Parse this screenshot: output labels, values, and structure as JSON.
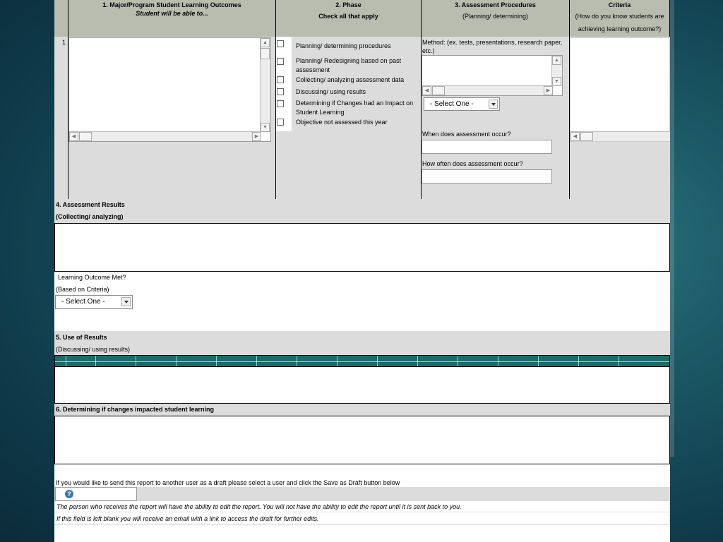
{
  "table_header": {
    "col1_title": "1. Major/Program Student Learning Outcomes",
    "col1_sub": "Student will be able to...",
    "col2_title": "2. Phase",
    "col2_sub": "Check all that apply",
    "col3_title": "3. Assessment Procedures",
    "col3_sub": "(Planning/ determining)",
    "col4_title": "Criteria",
    "col4_sub1": "(How do you know students are",
    "col4_sub2": "achieving learning outcome?)"
  },
  "row": {
    "number": "1",
    "phases": [
      "Planning/ determining procedures",
      "Planning/ Redesigning based on past assessment",
      "Collecting/ analyzing assessment data",
      "Discussing/ using results",
      "Determining if Changes had an Impact on Student Learning",
      "Objective not assessed this year"
    ],
    "method_label": "Method: (ex. tests, presentations, research paper, etc.)",
    "method_select": "- Select One -",
    "when_label": "When does assessment occur?",
    "often_label": "How often does assessment occur?"
  },
  "section4": {
    "title": "4. Assessment Results",
    "subtitle": "(Collecting/ analyzing)",
    "met_label": "Learning Outcome Met?",
    "met_sub": "(Based on Criteria)",
    "met_select": "- Select One -"
  },
  "section5": {
    "title": "5. Use of Results",
    "subtitle": "(Discussing/ using results)"
  },
  "section6": {
    "title": "6. Determining if changes impacted student learning"
  },
  "draft": {
    "instruction": "If you would like to send this report to another user as a draft please select a user and click the Save as Draft button below",
    "note1": "The person who receives the report will have the ability to edit the report.  You will not have the ability to edit the report until it is sent back to you.",
    "note2": "If this field is left blank you will receive an email with a link to access the draft for further edits."
  },
  "icons": {
    "help": "question-circle-icon"
  },
  "colors": {
    "header_bg": "#b9bdb0",
    "cell_bg": "#dcdcdc",
    "background": "#1c5a66"
  }
}
